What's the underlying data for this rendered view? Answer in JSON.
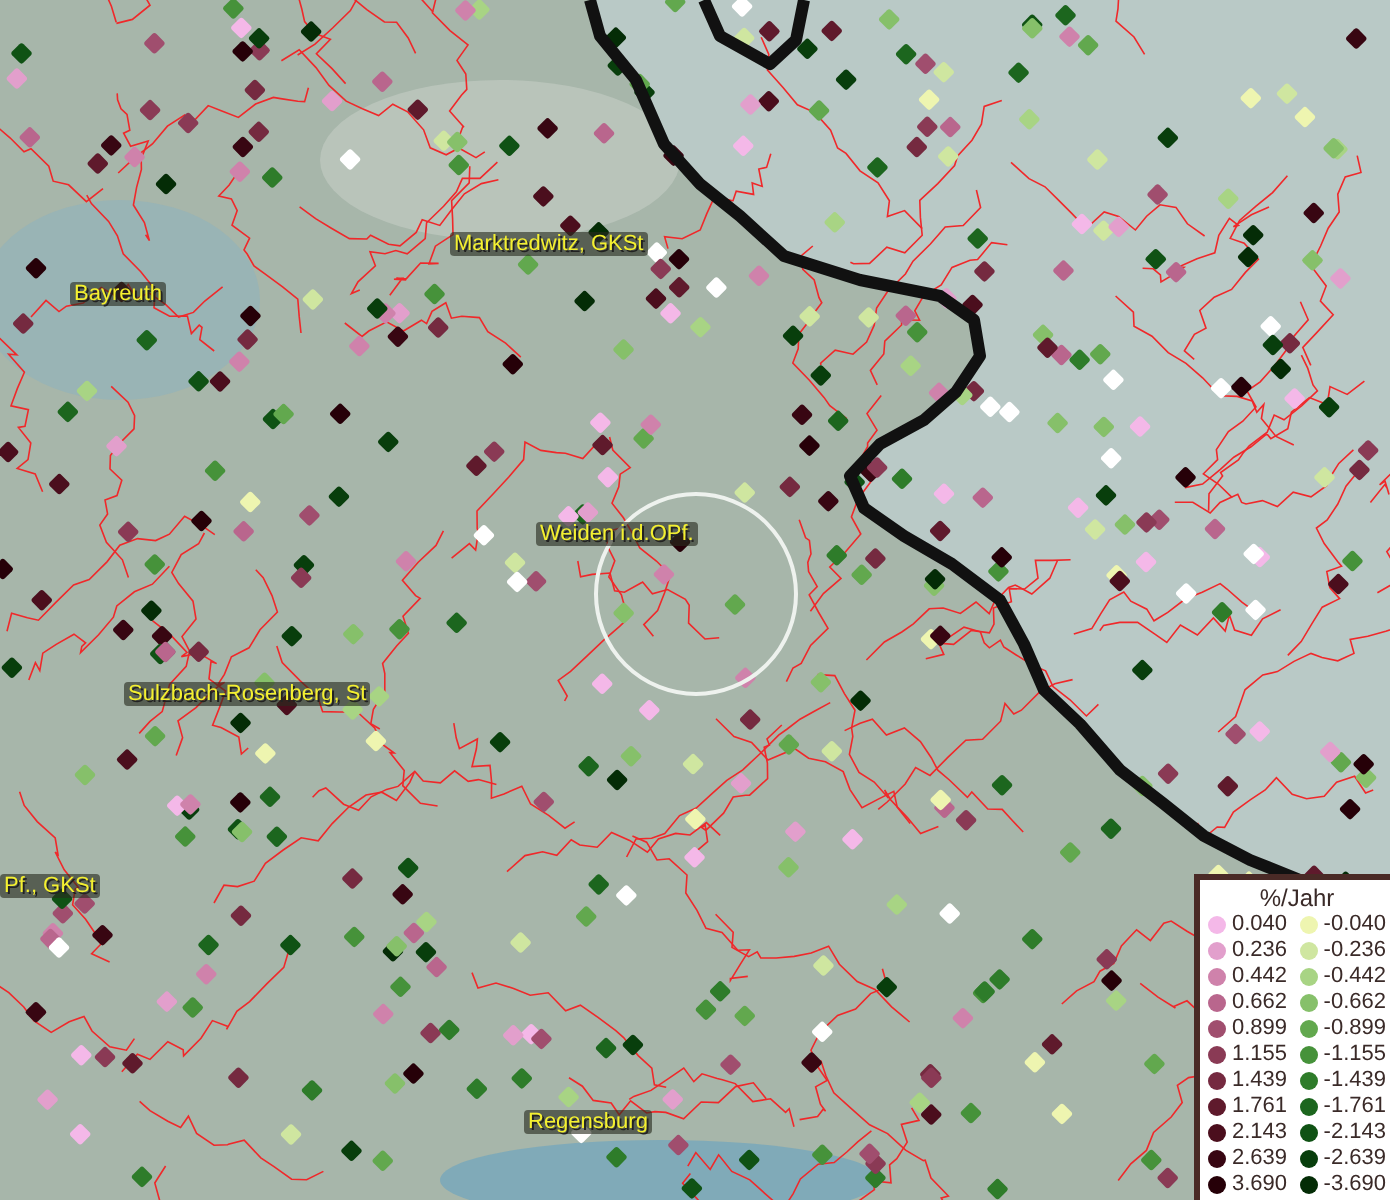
{
  "map": {
    "places": [
      {
        "label": "Marktredwitz, GKSt"
      },
      {
        "label": "Bayreuth"
      },
      {
        "label": "Weiden i.d.OPf."
      },
      {
        "label": "Sulzbach-Rosenberg, St"
      },
      {
        "label": "Pf., GKSt"
      },
      {
        "label": "Regensburg"
      }
    ]
  },
  "legend": {
    "title": "%/Jahr",
    "positive": [
      {
        "value": "0.040",
        "color": "#f4b8e8"
      },
      {
        "value": "0.236",
        "color": "#e29fcc"
      },
      {
        "value": "0.442",
        "color": "#cf82ab"
      },
      {
        "value": "0.662",
        "color": "#b9668d"
      },
      {
        "value": "0.899",
        "color": "#a04e6e"
      },
      {
        "value": "1.155",
        "color": "#8a3a55"
      },
      {
        "value": "1.439",
        "color": "#752a40"
      },
      {
        "value": "1.761",
        "color": "#5f1a2c"
      },
      {
        "value": "2.143",
        "color": "#4b0e1d"
      },
      {
        "value": "2.639",
        "color": "#380612"
      },
      {
        "value": "3.690",
        "color": "#260008"
      }
    ],
    "negative": [
      {
        "value": "-0.040",
        "color": "#eef5b0"
      },
      {
        "value": "-0.236",
        "color": "#cfe6a0"
      },
      {
        "value": "-0.442",
        "color": "#a8d484"
      },
      {
        "value": "-0.662",
        "color": "#86c06a"
      },
      {
        "value": "-0.899",
        "color": "#62a84e"
      },
      {
        "value": "-1.155",
        "color": "#46923a"
      },
      {
        "value": "-1.439",
        "color": "#2e7c2a"
      },
      {
        "value": "-1.761",
        "color": "#1c661e"
      },
      {
        "value": "-2.143",
        "color": "#0f5214"
      },
      {
        "value": "-2.639",
        "color": "#083e0c"
      },
      {
        "value": "-3.690",
        "color": "#042c06"
      }
    ]
  }
}
